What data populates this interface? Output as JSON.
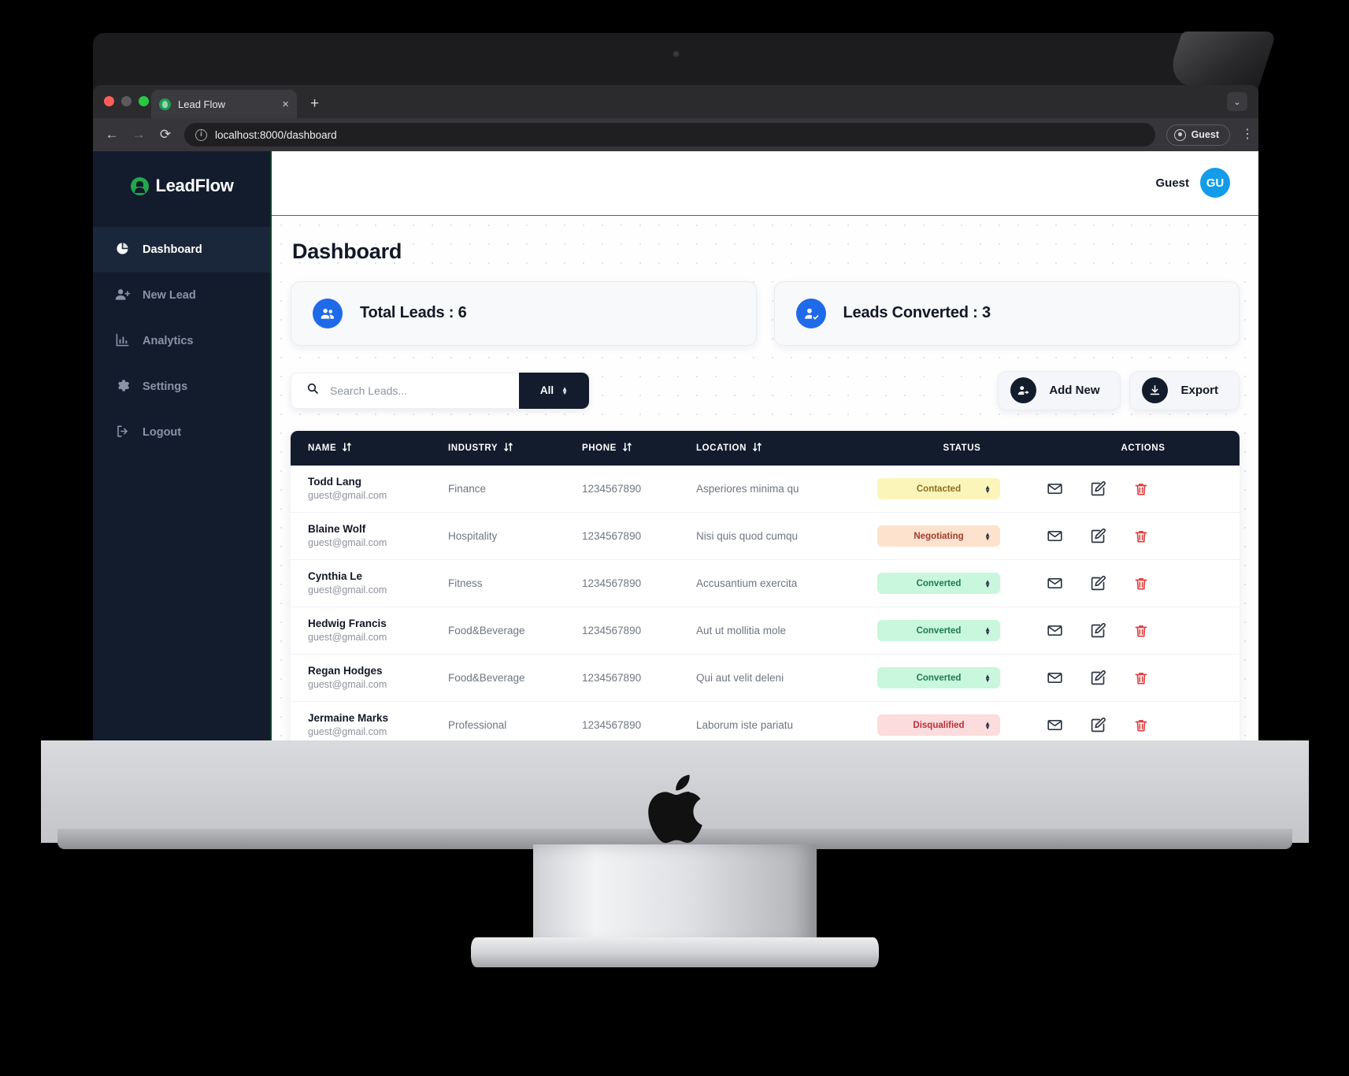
{
  "browser": {
    "tab_title": "Lead Flow",
    "tab_close": "×",
    "new_tab": "+",
    "url": "localhost:8000/dashboard",
    "profile_label": "Guest",
    "back": "←",
    "forward": "→",
    "reload": "⟳",
    "info_glyph": "i",
    "chevron": "⌄",
    "kebab": "⋮"
  },
  "sidebar": {
    "brand": "LeadFlow",
    "items": [
      {
        "label": "Dashboard",
        "icon": "pie-chart-icon",
        "active": true
      },
      {
        "label": "New Lead",
        "icon": "user-plus-icon",
        "active": false
      },
      {
        "label": "Analytics",
        "icon": "bar-chart-icon",
        "active": false
      },
      {
        "label": "Settings",
        "icon": "gear-icon",
        "active": false
      },
      {
        "label": "Logout",
        "icon": "logout-icon",
        "active": false
      }
    ]
  },
  "topbar": {
    "user_name": "Guest",
    "avatar_initials": "GU"
  },
  "page": {
    "title": "Dashboard"
  },
  "cards": [
    {
      "label": "Total Leads : 6",
      "icon": "users-icon",
      "color": "#1f6ae8"
    },
    {
      "label": "Leads Converted : 3",
      "icon": "user-check-icon",
      "color": "#1f6ae8"
    }
  ],
  "toolbar": {
    "search_placeholder": "Search Leads...",
    "search_value": "",
    "filter_value": "All",
    "filter_options": [
      "All"
    ],
    "add_new_label": "Add New",
    "export_label": "Export"
  },
  "table": {
    "columns": [
      {
        "label": "NAME",
        "sortable": true
      },
      {
        "label": "INDUSTRY",
        "sortable": true
      },
      {
        "label": "PHONE",
        "sortable": true
      },
      {
        "label": "LOCATION",
        "sortable": true
      },
      {
        "label": "STATUS",
        "sortable": false
      },
      {
        "label": "ACTIONS",
        "sortable": false
      }
    ],
    "rows": [
      {
        "name": "Todd Lang",
        "email": "guest@gmail.com",
        "industry": "Finance",
        "phone": "1234567890",
        "location": "Asperiores minima qu",
        "status": "Contacted",
        "status_class": "b-contacted"
      },
      {
        "name": "Blaine Wolf",
        "email": "guest@gmail.com",
        "industry": "Hospitality",
        "phone": "1234567890",
        "location": "Nisi quis quod cumqu",
        "status": "Negotiating",
        "status_class": "b-negotiating"
      },
      {
        "name": "Cynthia Le",
        "email": "guest@gmail.com",
        "industry": "Fitness",
        "phone": "1234567890",
        "location": "Accusantium exercita",
        "status": "Converted",
        "status_class": "b-converted"
      },
      {
        "name": "Hedwig Francis",
        "email": "guest@gmail.com",
        "industry": "Food&Beverage",
        "phone": "1234567890",
        "location": "Aut ut mollitia mole",
        "status": "Converted",
        "status_class": "b-converted"
      },
      {
        "name": "Regan Hodges",
        "email": "guest@gmail.com",
        "industry": "Food&Beverage",
        "phone": "1234567890",
        "location": "Qui aut velit deleni",
        "status": "Converted",
        "status_class": "b-converted"
      },
      {
        "name": "Jermaine Marks",
        "email": "guest@gmail.com",
        "industry": "Professional",
        "phone": "1234567890",
        "location": "Laborum iste pariatu",
        "status": "Disqualified",
        "status_class": "b-disqualified"
      }
    ],
    "row_actions": [
      "email-icon",
      "edit-icon",
      "delete-icon"
    ]
  },
  "pagination": {
    "first": "«",
    "prev": "‹",
    "next": "›",
    "last": "»"
  },
  "colors": {
    "sidebar_bg": "#121c2d",
    "accent_green": "#2f7d50",
    "accent_blue": "#1f6ae8",
    "avatar_blue": "#129cea",
    "delete_red": "#e03b3b"
  }
}
